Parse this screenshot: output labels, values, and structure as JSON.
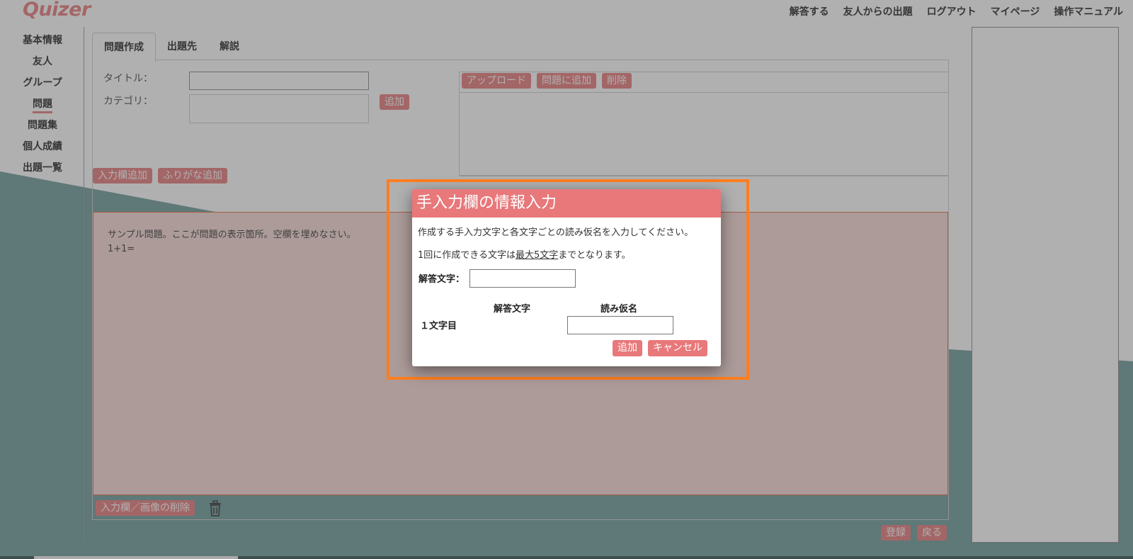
{
  "app": {
    "logo": "Quizer"
  },
  "topnav": [
    "解答する",
    "友人からの出題",
    "ログアウト",
    "マイページ",
    "操作マニュアル"
  ],
  "sidenav": [
    "基本情報",
    "友人",
    "グループ",
    "問題",
    "問題集",
    "個人成績",
    "出題一覧"
  ],
  "sidenav_active": "問題",
  "tabs": [
    "問題作成",
    "出題先",
    "解説"
  ],
  "form": {
    "title_label": "タイトル：",
    "category_label": "カテゴリ：",
    "category_add": "追加",
    "upload": "アップロード",
    "add_to_question": "問題に追加",
    "delete": "削除",
    "add_input": "入力欄追加",
    "add_furigana": "ふりがな追加",
    "question_lines": [
      "サンプル問題。ここが問題の表示箇所。空欄を埋めなさい。",
      "1+1="
    ],
    "delete_input_image": "入力欄／画像の削除",
    "register": "登録",
    "back": "戻る"
  },
  "modal": {
    "title": "手入力欄の情報入力",
    "desc1": "作成する手入力文字と各文字ごとの読み仮名を入力してください。",
    "desc2_prefix": "1回に作成できる文字は",
    "desc2_emph": "最大5文字",
    "desc2_suffix": "までとなります。",
    "answer_label": "解答文字：",
    "col_answer": "解答文字",
    "col_yomi": "読み仮名",
    "row1_label": "１文字目",
    "add_button": "追加",
    "cancel_button": "キャンセル"
  },
  "colors": {
    "accent": "#e8787a",
    "teal": "#6c9a99",
    "highlight": "#ff7e1f"
  }
}
